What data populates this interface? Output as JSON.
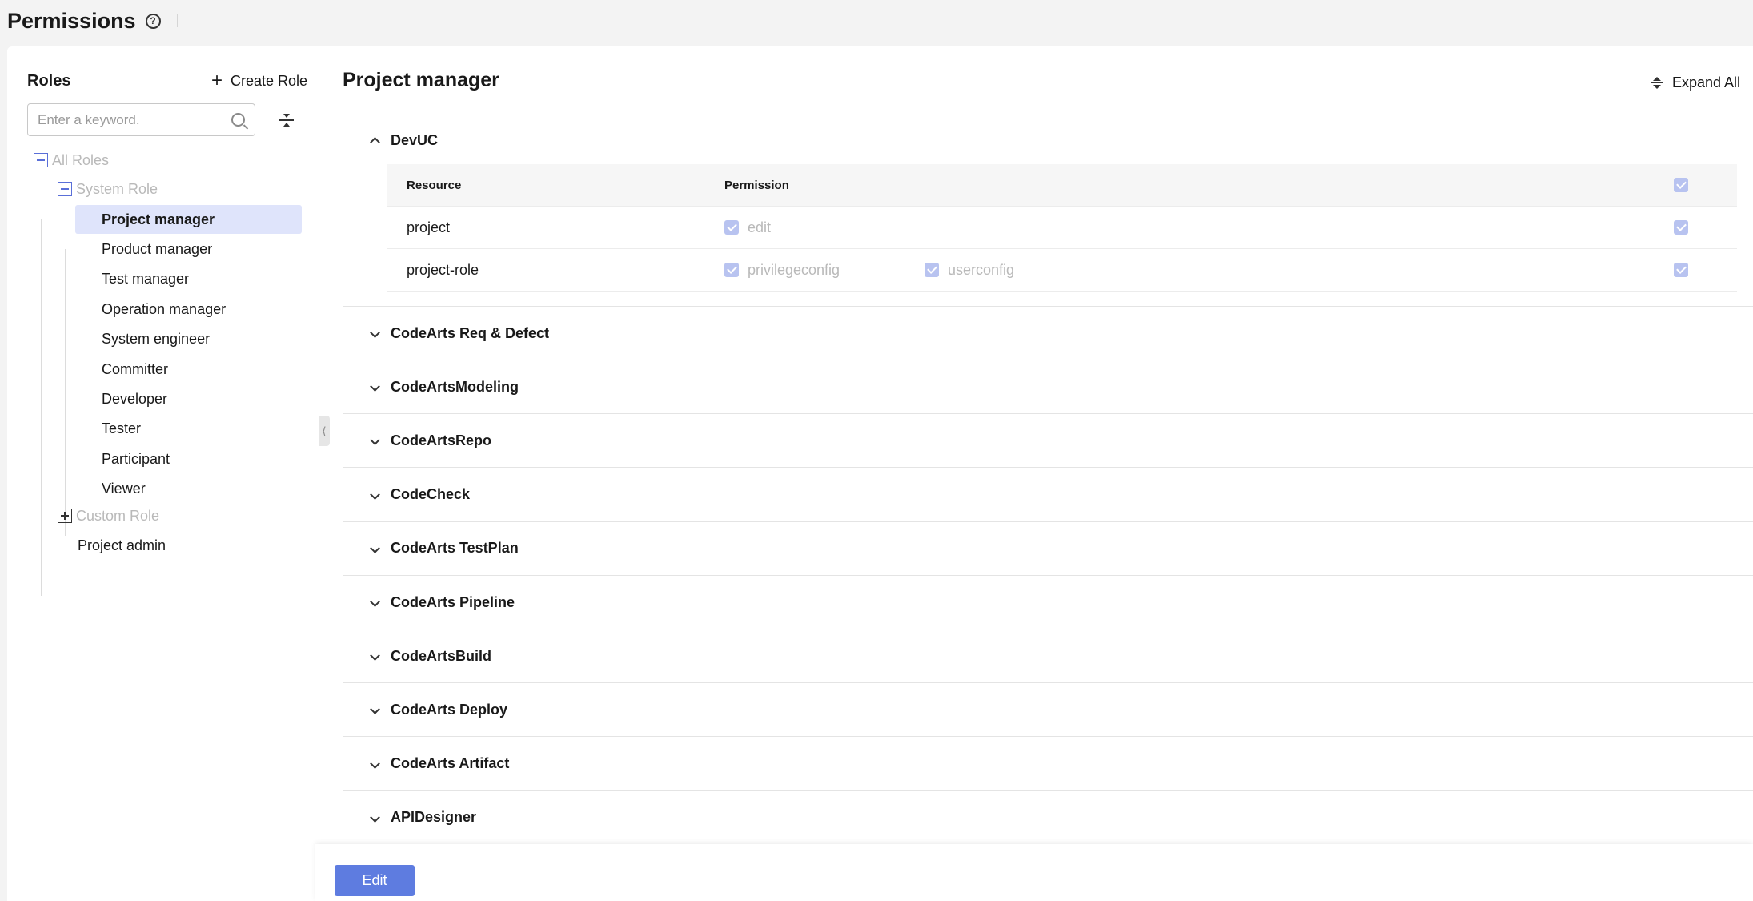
{
  "header": {
    "title": "Permissions"
  },
  "roles_panel": {
    "title": "Roles",
    "create_label": "Create Role",
    "search_placeholder": "Enter a keyword.",
    "root": "All Roles",
    "system_group": "System Role",
    "system_roles": [
      "Project manager",
      "Product manager",
      "Test manager",
      "Operation manager",
      "System engineer",
      "Committer",
      "Developer",
      "Tester",
      "Participant",
      "Viewer"
    ],
    "custom_group": "Custom Role",
    "extra_role": "Project admin",
    "selected_index": 0
  },
  "detail": {
    "role_title": "Project manager",
    "expand_all_label": "Expand All",
    "groups": [
      "DevUC",
      "CodeArts Req & Defect",
      "CodeArtsModeling",
      "CodeArtsRepo",
      "CodeCheck",
      "CodeArts TestPlan",
      "CodeArts Pipeline",
      "CodeArtsBuild",
      "CodeArts Deploy",
      "CodeArts Artifact",
      "APIDesigner"
    ],
    "table": {
      "headers": {
        "resource": "Resource",
        "permission": "Permission"
      },
      "rows": [
        {
          "resource": "project",
          "permissions": [
            "edit"
          ]
        },
        {
          "resource": "project-role",
          "permissions": [
            "privilegeconfig",
            "userconfig"
          ]
        }
      ]
    }
  },
  "footer": {
    "edit_label": "Edit"
  },
  "colors": {
    "primary": "#5e7ce0",
    "selected_bg": "#dfe4fb",
    "checkbox_disabled": "#b8c3f0"
  }
}
